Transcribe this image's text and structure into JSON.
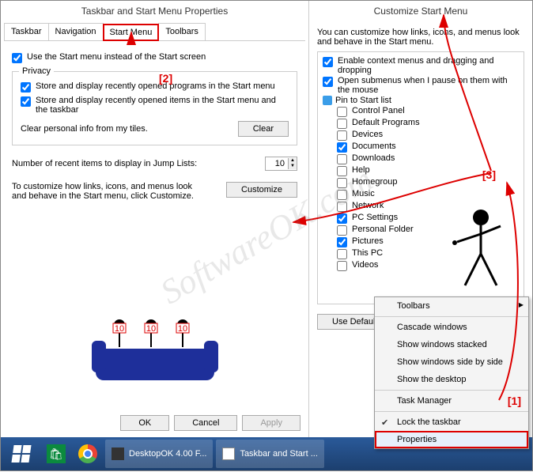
{
  "left_dialog": {
    "title": "Taskbar and Start Menu Properties",
    "tabs": [
      "Taskbar",
      "Navigation",
      "Start Menu",
      "Toolbars"
    ],
    "active_tab": "Start Menu",
    "use_start_menu": "Use the Start menu instead of the Start screen",
    "privacy_title": "Privacy",
    "priv1": "Store and display recently opened programs in the Start menu",
    "priv2": "Store and display recently opened items in the Start menu and the taskbar",
    "clear_label": "Clear personal info from my tiles.",
    "clear_btn": "Clear",
    "jump_label": "Number of recent items to display in Jump Lists:",
    "jump_value": "10",
    "custom_label": "To customize how links, icons, and menus look and behave in the Start menu, click Customize.",
    "custom_btn": "Customize",
    "ok": "OK",
    "cancel": "Cancel",
    "apply": "Apply"
  },
  "right_dialog": {
    "title": "Customize Start Menu",
    "desc": "You can customize how links, icons, and menus look and behave in the Start menu.",
    "items": [
      {
        "label": "Enable context menus and dragging and dropping",
        "checked": true,
        "type": "chk"
      },
      {
        "label": "Open submenus when I pause on them with the mouse",
        "checked": true,
        "type": "chk"
      },
      {
        "label": "Pin to Start list",
        "type": "pin"
      },
      {
        "label": "Control Panel",
        "checked": false,
        "type": "sub"
      },
      {
        "label": "Default Programs",
        "checked": false,
        "type": "sub"
      },
      {
        "label": "Devices",
        "checked": false,
        "type": "sub"
      },
      {
        "label": "Documents",
        "checked": true,
        "type": "sub"
      },
      {
        "label": "Downloads",
        "checked": false,
        "type": "sub"
      },
      {
        "label": "Help",
        "checked": false,
        "type": "sub"
      },
      {
        "label": "Homegroup",
        "checked": false,
        "type": "sub"
      },
      {
        "label": "Music",
        "checked": false,
        "type": "sub"
      },
      {
        "label": "Network",
        "checked": false,
        "type": "sub"
      },
      {
        "label": "PC Settings",
        "checked": true,
        "type": "sub"
      },
      {
        "label": "Personal Folder",
        "checked": false,
        "type": "sub"
      },
      {
        "label": "Pictures",
        "checked": true,
        "type": "sub"
      },
      {
        "label": "This PC",
        "checked": false,
        "type": "sub"
      },
      {
        "label": "Videos",
        "checked": false,
        "type": "sub"
      }
    ],
    "use_default": "Use Default Settings"
  },
  "context_menu": {
    "items": [
      {
        "label": "Toolbars",
        "arrow": true
      },
      {
        "sep": true
      },
      {
        "label": "Cascade windows"
      },
      {
        "label": "Show windows stacked"
      },
      {
        "label": "Show windows side by side"
      },
      {
        "label": "Show the desktop"
      },
      {
        "sep": true
      },
      {
        "label": "Task Manager"
      },
      {
        "sep": true
      },
      {
        "label": "Lock the taskbar",
        "checked": true
      },
      {
        "label": "Properties",
        "selected": true
      }
    ]
  },
  "taskbar": {
    "apps": [
      {
        "label": "DesktopOK 4.00 F..."
      },
      {
        "label": "Taskbar and Start ..."
      }
    ]
  },
  "annotations": {
    "a1": "[1]",
    "a2": "[2]",
    "a3": "[3]"
  },
  "watermark": "SoftwareOK.com"
}
